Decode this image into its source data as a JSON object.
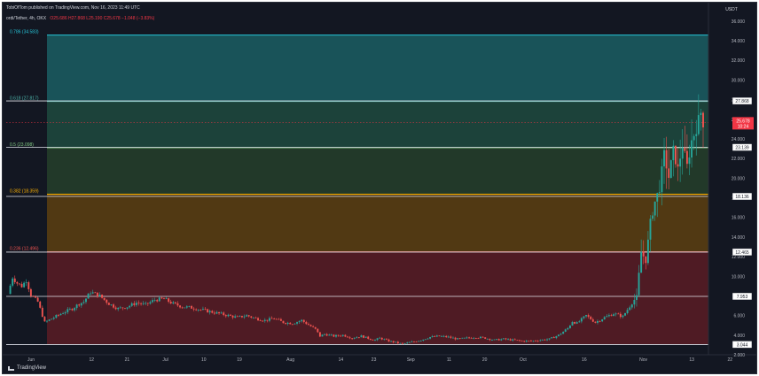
{
  "header": {
    "publisher": "TobiOfTom published on TradingView.com, Nov 16, 2023 11:49 UTC"
  },
  "symbol": {
    "name": "ordi/Tether, 4h, OKX",
    "ohlc": "O25.686 H27.868 L25.190 C25.678 −1.048 (−3.83%)"
  },
  "branding": {
    "logo_text": "TradingView"
  },
  "chart_data": {
    "type": "candlestick",
    "y_unit": "USDT",
    "ylim": [
      2,
      36.8
    ],
    "y_ticks": [
      {
        "value": 36,
        "label": "36.000"
      },
      {
        "value": 34,
        "label": "34.000"
      },
      {
        "value": 32,
        "label": "32.000"
      },
      {
        "value": 30,
        "label": "30.000"
      },
      {
        "value": 28,
        "label": "28.000"
      },
      {
        "value": 26,
        "label": "26.000"
      },
      {
        "value": 24,
        "label": "24.000"
      },
      {
        "value": 22,
        "label": "22.000"
      },
      {
        "value": 20,
        "label": "20.000"
      },
      {
        "value": 18,
        "label": "18.000"
      },
      {
        "value": 16,
        "label": "16.000"
      },
      {
        "value": 14,
        "label": "14.000"
      },
      {
        "value": 12,
        "label": "12.000"
      },
      {
        "value": 10,
        "label": "10.000"
      },
      {
        "value": 8,
        "label": "8.000"
      },
      {
        "value": 6,
        "label": "6.000"
      },
      {
        "value": 4,
        "label": "4.000"
      },
      {
        "value": 2,
        "label": "2.000"
      }
    ],
    "x_ticks": [
      "Jun",
      "12",
      "21",
      "Jul",
      "10",
      "19",
      "Aug",
      "14",
      "23",
      "Sep",
      "11",
      "20",
      "Oct",
      "16",
      "Nov",
      "13",
      "22"
    ],
    "fib_levels": [
      {
        "label": "0.786 (34.583)",
        "value": 34.583,
        "color": "#26c6da"
      },
      {
        "label": "0.618 (27.817)",
        "value": 27.817,
        "color": "#4db6ac"
      },
      {
        "label": "0.5 (23.098)",
        "value": 23.098,
        "color": "#81c784"
      },
      {
        "label": "0.382 (18.359)",
        "value": 18.359,
        "color": "#ffb300"
      },
      {
        "label": "0.236 (12.496)",
        "value": 12.496,
        "color": "#ef5350"
      }
    ],
    "fib_zones": [
      {
        "from": 27.817,
        "to": 34.583,
        "color": "#1b5e63"
      },
      {
        "from": 23.098,
        "to": 27.817,
        "color": "#1e4a3e"
      },
      {
        "from": 18.359,
        "to": 23.098,
        "color": "#26402a"
      },
      {
        "from": 12.496,
        "to": 18.359,
        "color": "#5d3f10"
      },
      {
        "from": 3.044,
        "to": 12.496,
        "color": "#5a1c25"
      }
    ],
    "horizontal_lines": [
      {
        "value": 27.868,
        "label": "27.868"
      },
      {
        "value": 23.139,
        "label": "23.139"
      },
      {
        "value": 18.136,
        "label": "18.136"
      },
      {
        "value": 12.465,
        "label": "12.465"
      },
      {
        "value": 7.953,
        "label": "7.953"
      },
      {
        "value": 3.044,
        "label": "3.044"
      }
    ],
    "last_price": {
      "label": "25.678",
      "countdown": "10:24",
      "value": 25.678,
      "color": "#f23645"
    },
    "up_color": "#26a69a",
    "down_color": "#ef5350",
    "close_path": [
      [
        0,
        8.2
      ],
      [
        2,
        9.9
      ],
      [
        4,
        9.3
      ],
      [
        6,
        9.0
      ],
      [
        8,
        9.6
      ],
      [
        10,
        8.1
      ],
      [
        13,
        7.4
      ],
      [
        16,
        5.3
      ],
      [
        20,
        5.8
      ],
      [
        24,
        6.3
      ],
      [
        28,
        6.7
      ],
      [
        31,
        7.2
      ],
      [
        33,
        7.4
      ],
      [
        36,
        8.4
      ],
      [
        40,
        8.0
      ],
      [
        44,
        7.2
      ],
      [
        48,
        6.7
      ],
      [
        52,
        6.9
      ],
      [
        56,
        7.3
      ],
      [
        60,
        7.1
      ],
      [
        64,
        7.6
      ],
      [
        68,
        7.7
      ],
      [
        72,
        7.2
      ],
      [
        76,
        6.9
      ],
      [
        80,
        6.8
      ],
      [
        84,
        6.6
      ],
      [
        88,
        6.4
      ],
      [
        92,
        6.2
      ],
      [
        96,
        6.0
      ],
      [
        100,
        5.8
      ],
      [
        104,
        6.0
      ],
      [
        108,
        5.7
      ],
      [
        112,
        5.5
      ],
      [
        116,
        5.7
      ],
      [
        120,
        5.3
      ],
      [
        124,
        5.2
      ],
      [
        128,
        5.5
      ],
      [
        132,
        4.9
      ],
      [
        134,
        4.6
      ],
      [
        136,
        3.9
      ],
      [
        138,
        4.1
      ],
      [
        142,
        3.9
      ],
      [
        146,
        4.0
      ],
      [
        150,
        3.7
      ],
      [
        154,
        3.9
      ],
      [
        158,
        3.6
      ],
      [
        160,
        3.5
      ],
      [
        162,
        3.7
      ],
      [
        166,
        3.4
      ],
      [
        170,
        3.2
      ],
      [
        172,
        3.1
      ],
      [
        176,
        3.3
      ],
      [
        180,
        3.5
      ],
      [
        184,
        3.8
      ],
      [
        188,
        3.9
      ],
      [
        192,
        3.8
      ],
      [
        196,
        3.6
      ],
      [
        200,
        3.7
      ],
      [
        204,
        3.8
      ],
      [
        208,
        3.7
      ],
      [
        212,
        3.5
      ],
      [
        216,
        3.6
      ],
      [
        220,
        3.5
      ],
      [
        224,
        3.4
      ],
      [
        228,
        3.4
      ],
      [
        232,
        3.5
      ],
      [
        236,
        3.6
      ],
      [
        240,
        4.0
      ],
      [
        244,
        4.7
      ],
      [
        246,
        5.4
      ],
      [
        248,
        5.2
      ],
      [
        252,
        6.0
      ],
      [
        256,
        5.3
      ],
      [
        260,
        5.8
      ],
      [
        264,
        6.2
      ],
      [
        268,
        5.9
      ],
      [
        272,
        7.3
      ],
      [
        274,
        7.9
      ],
      [
        276,
        12.5
      ],
      [
        278,
        11.6
      ],
      [
        280,
        15.5
      ],
      [
        282,
        17.6
      ],
      [
        284,
        19.0
      ],
      [
        286,
        22.4
      ],
      [
        288,
        20.1
      ],
      [
        290,
        22.8
      ],
      [
        292,
        20.9
      ],
      [
        294,
        23.4
      ],
      [
        296,
        21.2
      ],
      [
        298,
        23.8
      ],
      [
        300,
        25.1
      ],
      [
        302,
        26.7
      ],
      [
        303,
        25.678
      ]
    ]
  }
}
